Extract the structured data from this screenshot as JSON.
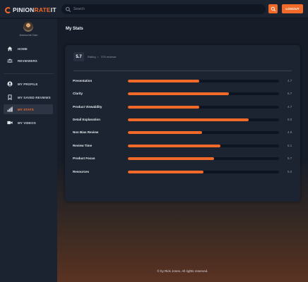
{
  "header": {
    "logo_part1": "PINION",
    "logo_part2": "RATE",
    "logo_part3": "IT",
    "search_placeholder": "Search",
    "logout_label": "LOGOUT"
  },
  "sidebar": {
    "user_name": "Awesome Dan",
    "items": [
      {
        "label": "HOME",
        "icon": "home-icon"
      },
      {
        "label": "REVIEWERS",
        "icon": "users-icon"
      },
      {
        "label": "MY PROFILE",
        "icon": "profile-icon"
      },
      {
        "label": "MY SAVED REVIEWS",
        "icon": "bookmark-icon"
      },
      {
        "label": "MY STATS",
        "icon": "stats-icon",
        "active": true
      },
      {
        "label": "MY VIDEOS",
        "icon": "video-icon"
      }
    ]
  },
  "main": {
    "title": "My Stats",
    "score": "5.7",
    "rating_label": "Rating",
    "separator": "•",
    "reviews_label": "376 reviews",
    "stats": [
      {
        "label": "Presentation",
        "value": "4.7",
        "fill": 0.47
      },
      {
        "label": "Clarity",
        "value": "6.7",
        "fill": 0.67
      },
      {
        "label": "Product Viewability",
        "value": "4.7",
        "fill": 0.47
      },
      {
        "label": "Detail Explanation",
        "value": "8.0",
        "fill": 0.8
      },
      {
        "label": "Non Bias Review",
        "value": "4.9",
        "fill": 0.49
      },
      {
        "label": "Review Time",
        "value": "6.1",
        "fill": 0.61
      },
      {
        "label": "Product Focus",
        "value": "5.7",
        "fill": 0.57
      },
      {
        "label": "Resources",
        "value": "5.0",
        "fill": 0.5
      }
    ],
    "footer": "© by Rick Jones. All rights reserved."
  },
  "colors": {
    "accent": "#f26a2a",
    "background": "#151c27",
    "panel": "#1c2431"
  }
}
